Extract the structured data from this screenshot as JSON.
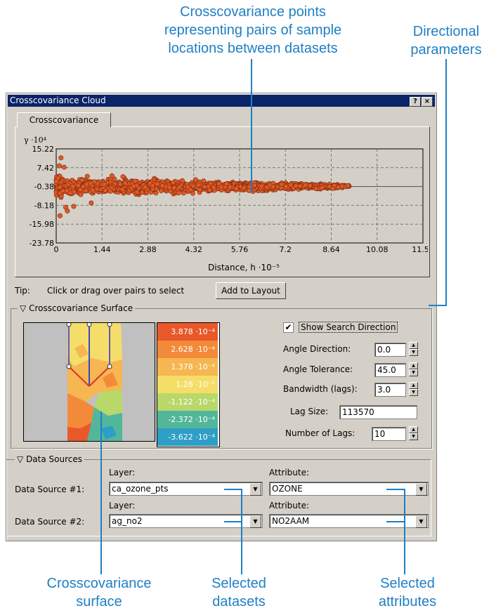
{
  "callouts": {
    "points": [
      "Crosscovariance points",
      "representing pairs of sample",
      "locations between datasets"
    ],
    "directional": [
      "Directional",
      "parameters"
    ],
    "surface": [
      "Crosscovariance",
      "surface"
    ],
    "datasets": [
      "Selected",
      "datasets"
    ],
    "attributes": [
      "Selected",
      "attributes"
    ]
  },
  "window": {
    "title": "Crosscovariance Cloud",
    "help_btn": "?",
    "close_btn": "×",
    "tab_label": "Crosscovariance"
  },
  "chart_data": {
    "type": "scatter",
    "ylabel": "γ ·10⁴",
    "xlabel": "Distance, h ·10⁻⁵",
    "x_ticks": [
      "0",
      "1.44",
      "2.88",
      "4.32",
      "5.76",
      "7.2",
      "8.64",
      "10.08",
      "11.52"
    ],
    "y_ticks": [
      "15.22",
      "7.42",
      "-0.38",
      "-8.18",
      "-15.98",
      "-23.78"
    ],
    "xlim": [
      0,
      11.52
    ],
    "ylim": [
      -23.78,
      15.22
    ],
    "grid": true,
    "point_color": "#e05a25",
    "cloud": {
      "x_range": [
        0,
        9.2
      ],
      "y_center": -0.38,
      "spread_near": 6,
      "spread_far": 1
    }
  },
  "tip": {
    "label": "Tip:",
    "text": "Click or drag over pairs to select",
    "button": "Add to Layout"
  },
  "surface": {
    "group_label": "Crosscovariance Surface",
    "legend": [
      {
        "value": "3.878",
        "unit": "·10⁻⁴",
        "color": "#e8582a"
      },
      {
        "value": "2.628",
        "unit": "·10⁻⁴",
        "color": "#f38a3a"
      },
      {
        "value": "1.378",
        "unit": "·10⁻⁴",
        "color": "#f6b651"
      },
      {
        "value": "1.28",
        "unit": "·10⁻⁵",
        "color": "#f5dd6a"
      },
      {
        "value": "-1.122",
        "unit": "·10⁻⁴",
        "color": "#b9d86a"
      },
      {
        "value": "-2.372",
        "unit": "·10⁻⁴",
        "color": "#52b79a"
      },
      {
        "value": "-3.622",
        "unit": "·10⁻⁴",
        "color": "#2f9ec6"
      }
    ]
  },
  "params": {
    "show_search_direction": "Show Search Direction",
    "angle_direction_label": "Angle Direction:",
    "angle_direction": "0.0",
    "angle_tolerance_label": "Angle Tolerance:",
    "angle_tolerance": "45.0",
    "bandwidth_label": "Bandwidth (lags):",
    "bandwidth": "3.0",
    "lag_size_label": "Lag Size:",
    "lag_size": "113570",
    "num_lags_label": "Number of Lags:",
    "num_lags": "10"
  },
  "data_sources": {
    "group_label": "Data Sources",
    "layer_header": "Layer:",
    "attribute_header": "Attribute:",
    "ds1_label": "Data Source #1:",
    "ds1_layer": "ca_ozone_pts",
    "ds1_attribute": "OZONE",
    "ds2_label": "Data Source #2:",
    "ds2_layer": "ag_no2",
    "ds2_attribute": "NO2AAM"
  }
}
